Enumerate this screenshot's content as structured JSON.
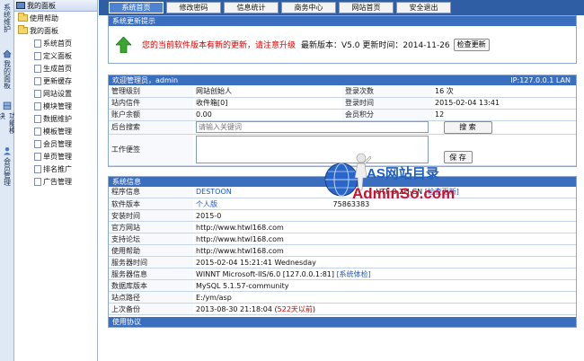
{
  "vstrip": {
    "sections": [
      {
        "text": "系统维护"
      },
      {
        "text": "我的面板"
      },
      {
        "text": "功能模块"
      },
      {
        "text": "会员管理"
      }
    ]
  },
  "tree": {
    "title": "我的面板",
    "roots": [
      {
        "label": "使用帮助"
      },
      {
        "label": "我的面板"
      }
    ],
    "children": [
      {
        "label": "系统首页"
      },
      {
        "label": "定义面板"
      },
      {
        "label": "生成首页"
      },
      {
        "label": "更新缓存"
      },
      {
        "label": "网站设置"
      },
      {
        "label": "模块管理"
      },
      {
        "label": "数据维护"
      },
      {
        "label": "模板管理"
      },
      {
        "label": "会员管理"
      },
      {
        "label": "单页管理"
      },
      {
        "label": "排名推广"
      },
      {
        "label": "广告管理"
      }
    ]
  },
  "tabs": [
    {
      "label": "系统首页",
      "active": true
    },
    {
      "label": "修改密码",
      "active": false
    },
    {
      "label": "信息统计",
      "active": false
    },
    {
      "label": "商务中心",
      "active": false
    },
    {
      "label": "网站首页",
      "active": false
    },
    {
      "label": "安全退出",
      "active": false
    }
  ],
  "update": {
    "header": "系统更新提示",
    "warning": "您的当前软件版本有新的更新，请注意升级",
    "version_info": "最新版本：V5.0 更新时间：2014-11-26",
    "check_button": "检查更新"
  },
  "admin": {
    "header": "欢迎管理员，admin",
    "ip": "IP:127.0.0.1 LAN",
    "rows": [
      {
        "l1": "管理级别",
        "v1": "网站创始人",
        "l2": "登录次数",
        "v2": "16 次"
      },
      {
        "l1": "站内信件",
        "v1": "收件箱[0]",
        "l2": "登录时间",
        "v2": "2015-02-04 13:41"
      },
      {
        "l1": "账户余额",
        "v1": "0.00",
        "l2": "会员积分",
        "v2": "12"
      }
    ],
    "search_label": "后台搜索",
    "search_placeholder": "请输入关键词",
    "search_button": "搜 索",
    "memo_label": "工作便签",
    "save_button": "保 存"
  },
  "sysinfo": {
    "header": "系统信息",
    "rows": [
      {
        "label": "程序信息",
        "value": "DESTOON",
        "extra": "UTF-8 ZH-CN",
        "link": "[检查更新]"
      },
      {
        "label": "软件版本",
        "value": "个人版",
        "extra": "75863383"
      },
      {
        "label": "安装时间",
        "value": "2015-0"
      },
      {
        "label": "官方网站",
        "value": "http://www.htwl168.com"
      },
      {
        "label": "支持论坛",
        "value": "http://www.htwl168.com"
      },
      {
        "label": "使用帮助",
        "value": "http://www.htwl168.com"
      },
      {
        "label": "服务器时间",
        "value": "2015-02-04 15:21:41 Wednesday"
      },
      {
        "label": "服务器信息",
        "value": "WINNT Microsoft-IIS/6.0 [127.0.0.1:81]",
        "link": "[系统体检]"
      },
      {
        "label": "数据库版本",
        "value": "MySQL 5.1.57-community"
      },
      {
        "label": "站点路径",
        "value": "E:/ym/asp"
      },
      {
        "label": "上次备份",
        "value": "2013-08-30 21:18:04 (",
        "red": "522天以前",
        "tail": ")"
      }
    ]
  },
  "agreement": {
    "header": "使用协议"
  },
  "watermark": {
    "line1": "AS网站目录",
    "line2": "AdminSo.com"
  }
}
